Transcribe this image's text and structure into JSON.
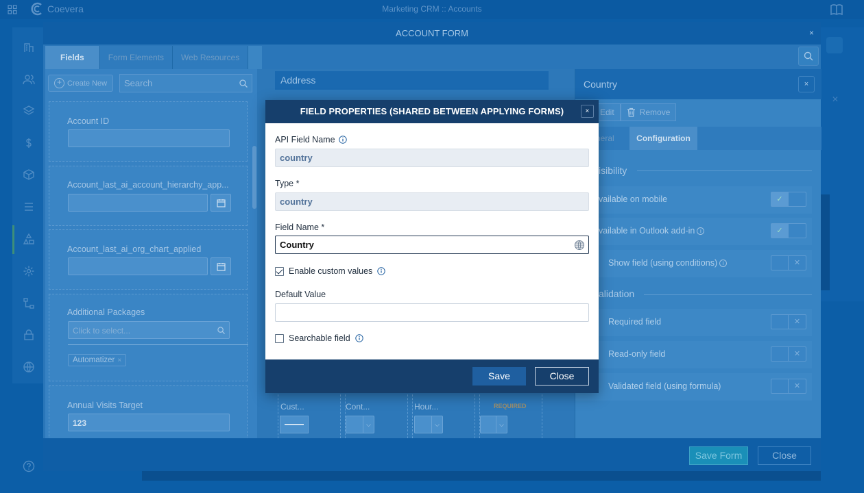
{
  "app": {
    "brand": "Coevera",
    "title": "Marketing CRM :: Accounts"
  },
  "account_form": {
    "title": "ACCOUNT FORM",
    "close_symbol": "×",
    "tabs": [
      {
        "label": "Fields"
      },
      {
        "label": "Form Elements"
      },
      {
        "label": "Web Resources"
      }
    ],
    "create_new_label": "Create New",
    "search_placeholder": "Search",
    "fields": [
      {
        "label": "Account ID",
        "value": ""
      },
      {
        "label": "Account_last_ai_account_hierarchy_app...",
        "value": ""
      },
      {
        "label": "Account_last_ai_org_chart_applied",
        "value": ""
      },
      {
        "label": "Additional Packages",
        "placeholder": "Click to select...",
        "chip": "Automatizer"
      },
      {
        "label": "Annual Visits Target",
        "value": "123"
      }
    ],
    "middle": {
      "section_title": "Address",
      "cards": [
        {
          "label": "Cust..."
        },
        {
          "label": "Cont..."
        },
        {
          "label": "Hour..."
        },
        {
          "label": "REQUIRED"
        }
      ]
    },
    "footer": {
      "save_label": "Save Form",
      "close_label": "Close"
    }
  },
  "country_panel": {
    "title": "Country",
    "close_symbol": "×",
    "edit_label": "Edit",
    "remove_label": "Remove",
    "tabs": [
      {
        "label": "neral"
      },
      {
        "label": "Configuration"
      }
    ],
    "sections": {
      "visibility": "isibility",
      "validation": "alidation"
    },
    "rows": [
      {
        "label": "vailable on mobile",
        "state": "on"
      },
      {
        "label": "vailable in Outlook add-in",
        "state": "on"
      },
      {
        "label": "Show field (using conditions)",
        "state": "off"
      },
      {
        "label": "Required field",
        "state": "off"
      },
      {
        "label": "Read-only field",
        "state": "off"
      },
      {
        "label": "Validated field (using formula)",
        "state": "off"
      }
    ]
  },
  "dialog": {
    "title": "FIELD PROPERTIES (SHARED BETWEEN APPLYING FORMS)",
    "close_symbol": "×",
    "api_field_name_label": "API Field Name",
    "api_field_name_value": "country",
    "type_label": "Type *",
    "type_value": "country",
    "field_name_label": "Field Name *",
    "field_name_value": "Country",
    "enable_custom_values_label": "Enable custom values",
    "enable_custom_values_checked": true,
    "default_value_label": "Default Value",
    "default_value": "",
    "searchable_field_label": "Searchable field",
    "searchable_field_checked": false,
    "save_label": "Save",
    "close_label": "Close"
  },
  "colors": {
    "dialog_header": "#163f6c",
    "overlay": "#0c5ea7",
    "save_button": "#1f5fa0"
  }
}
